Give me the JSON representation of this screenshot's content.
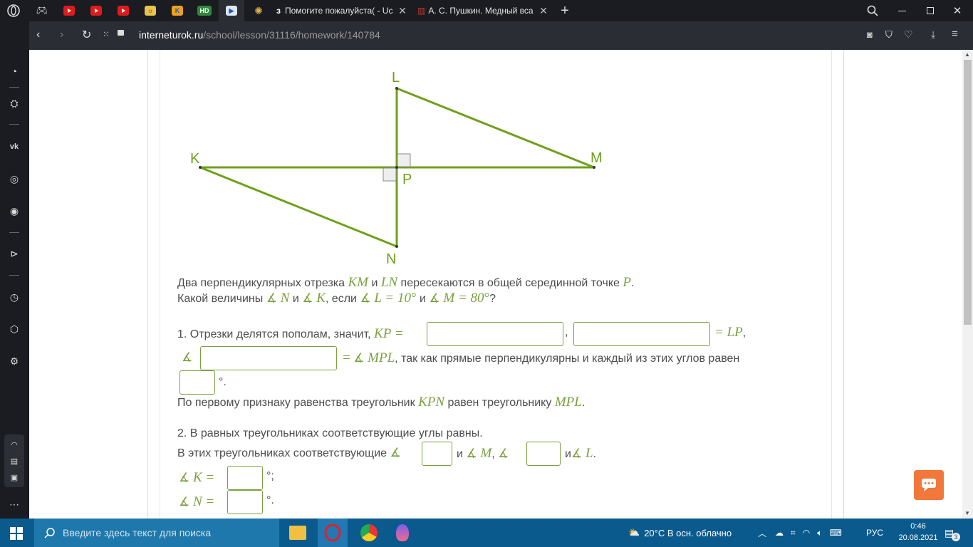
{
  "browser": {
    "tabs": [
      {
        "icon": "opera-logo-icon"
      },
      {
        "icon": "gamepad-icon"
      },
      {
        "icon": "youtube-icon"
      },
      {
        "icon": "youtube-icon"
      },
      {
        "icon": "youtube-icon"
      },
      {
        "icon": "sun-game-icon"
      },
      {
        "icon": "k-icon"
      },
      {
        "icon": "hd-icon",
        "label": "HD"
      },
      {
        "icon": "interneturok-icon"
      },
      {
        "icon": "film-reel-icon"
      }
    ],
    "named_tabs": [
      {
        "label": "Помогите пожалуйста( - Uc"
      },
      {
        "label": "А. С. Пушкин. Медный вса"
      }
    ],
    "url_domain": "interneturok.ru",
    "url_path": "/school/lesson/31116/homework/140784"
  },
  "figure": {
    "labels": {
      "L": "L",
      "K": "K",
      "M": "M",
      "P": "P",
      "N": "N"
    }
  },
  "task": {
    "line1_a": "Два перпендикулярных отрезка ",
    "KM": "KM",
    "and": " и ",
    "LN": "LN",
    "line1_b": " пересекаются в общей серединной точке ",
    "P": "P",
    "dot": ".",
    "line2_a": "Какой величины ",
    "angle": "∡",
    "N": " N",
    "K": " K",
    "if": ", если ",
    "L10": " L = 10",
    "deg": "°",
    "M80": " M = 80",
    "q": "?",
    "s1_a": "1. Отрезки делятся пополам, значит, ",
    "KPeq": "KP =",
    "comma": ",",
    "eqLP": "= LP",
    "eq": "=",
    "MPL": " MPL",
    "s1_b": ", так как прямые перпендикулярны и каждый из этих углов равен",
    "deg_dot": "°.",
    "s1_c": "По первому признаку равенства треугольник ",
    "KPN": "KPN",
    "s1_d": " равен треугольнику ",
    "MPL2": "MPL",
    "s2_a": "2. В равных треугольниках соответствующие углы равны.",
    "s2_b": "В этих треугольниках соответствующие ",
    "i": "и ",
    "Mc": " M",
    "i2": "и",
    "Ld": " L",
    "Keq": " K =",
    "deg_semi": "°;",
    "Neq": " N ="
  },
  "taskbar": {
    "search_placeholder": "Введите здесь текст для поиска",
    "weather": "20°C  В осн. облачно",
    "lang": "РУС",
    "time": "0:46",
    "date": "20.08.2021",
    "notifications": "3"
  },
  "colors": {
    "accent": "#79a13f",
    "figure": "#6fa01c"
  }
}
